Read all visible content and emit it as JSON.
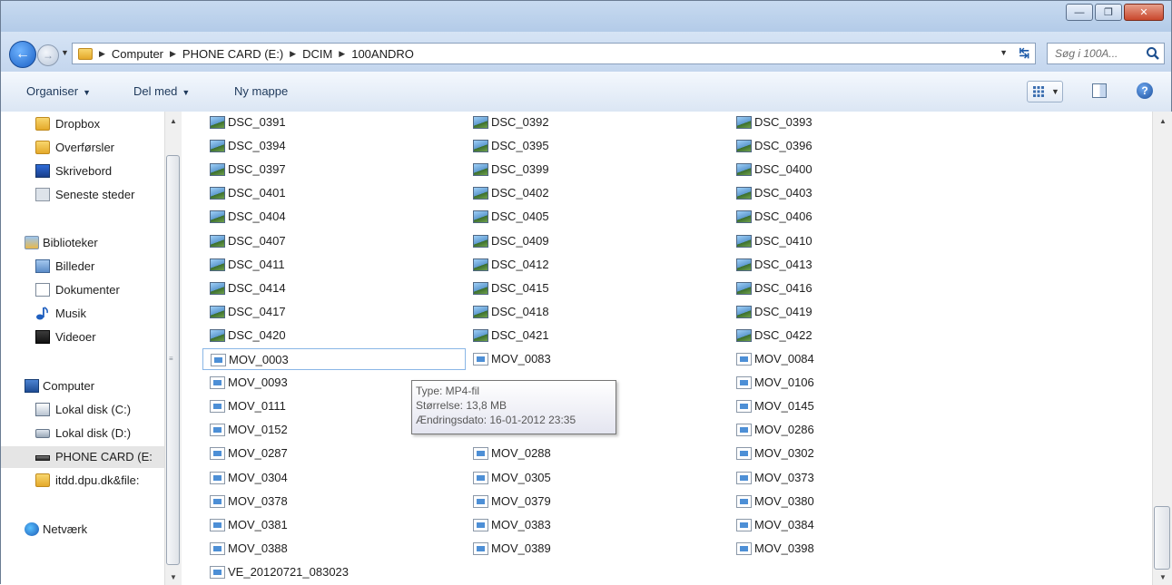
{
  "breadcrumb": [
    "Computer",
    "PHONE CARD (E:)",
    "DCIM",
    "100ANDRO"
  ],
  "search": {
    "placeholder": "Søg i 100A..."
  },
  "toolbar": {
    "organize": "Organiser",
    "share": "Del med",
    "new_folder": "Ny mappe"
  },
  "navpane": {
    "items": [
      {
        "label": "Dropbox",
        "icon": "folder-icon"
      },
      {
        "label": "Overførsler",
        "icon": "download-folder-icon"
      },
      {
        "label": "Skrivebord",
        "icon": "desktop-icon"
      },
      {
        "label": "Seneste steder",
        "icon": "recent-places-icon"
      },
      {
        "label": "Biblioteker",
        "icon": "libraries-icon"
      },
      {
        "label": "Billeder",
        "icon": "pictures-icon"
      },
      {
        "label": "Dokumenter",
        "icon": "documents-icon"
      },
      {
        "label": "Musik",
        "icon": "music-icon"
      },
      {
        "label": "Videoer",
        "icon": "videos-icon"
      },
      {
        "label": "Computer",
        "icon": "computer-icon"
      },
      {
        "label": "Lokal disk (C:)",
        "icon": "windows-drive-icon"
      },
      {
        "label": "Lokal disk (D:)",
        "icon": "drive-icon"
      },
      {
        "label": "PHONE CARD (E:",
        "icon": "removable-drive-icon",
        "selected": true
      },
      {
        "label": "itdd.dpu.dk&file:",
        "icon": "folder-icon"
      },
      {
        "label": "Netværk",
        "icon": "network-icon"
      }
    ]
  },
  "files": {
    "col1": [
      "DSC_0391",
      "DSC_0394",
      "DSC_0397",
      "DSC_0401",
      "DSC_0404",
      "DSC_0407",
      "DSC_0411",
      "DSC_0414",
      "DSC_0417",
      "DSC_0420",
      "MOV_0003",
      "MOV_0093",
      "MOV_0111",
      "MOV_0152",
      "MOV_0287",
      "MOV_0304",
      "MOV_0378",
      "MOV_0381",
      "MOV_0388",
      "VE_20120721_083023"
    ],
    "col2": [
      "DSC_0392",
      "DSC_0395",
      "DSC_0399",
      "DSC_0402",
      "DSC_0405",
      "DSC_0409",
      "DSC_0412",
      "DSC_0415",
      "DSC_0418",
      "DSC_0421",
      "MOV_0083",
      "",
      "",
      "",
      "MOV_0288",
      "MOV_0305",
      "MOV_0379",
      "MOV_0383",
      "MOV_0389"
    ],
    "col3": [
      "DSC_0393",
      "DSC_0396",
      "DSC_0400",
      "DSC_0403",
      "DSC_0406",
      "DSC_0410",
      "DSC_0413",
      "DSC_0416",
      "DSC_0419",
      "DSC_0422",
      "MOV_0084",
      "MOV_0106",
      "MOV_0145",
      "MOV_0286",
      "MOV_0302",
      "MOV_0373",
      "MOV_0380",
      "MOV_0384",
      "MOV_0398"
    ]
  },
  "tooltip": {
    "type": "Type: MP4-fil",
    "size": "Størrelse: 13,8 MB",
    "modified": "Ændringsdato: 16-01-2012 23:35"
  },
  "hover_file": "MOV_0003"
}
